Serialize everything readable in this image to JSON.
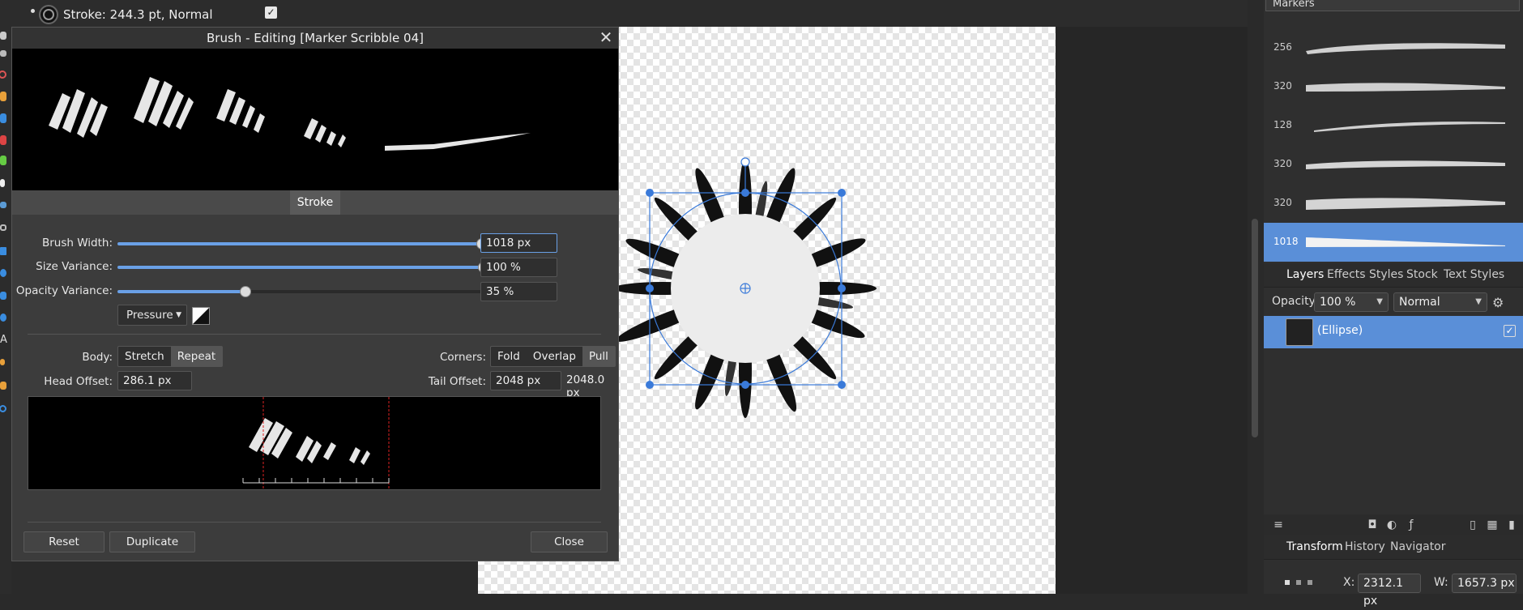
{
  "context_bar": {
    "stroke_text": "Stroke: 244.3 pt,  Normal",
    "checkbox": "✓"
  },
  "brushes_panel": {
    "category": "Markers",
    "brushes": [
      {
        "size": "256"
      },
      {
        "size": "320"
      },
      {
        "size": "128"
      },
      {
        "size": "320"
      },
      {
        "size": "320"
      },
      {
        "size": "1018",
        "selected": true
      }
    ]
  },
  "layers_panel": {
    "tabs": [
      "Layers",
      "Effects",
      "Styles",
      "Stock",
      "Text Styles"
    ],
    "opacity_label": "Opacity:",
    "opacity_value": "100 %",
    "blend_mode": "Normal",
    "layer_name": "(Ellipse)",
    "layer_visible": "✓"
  },
  "transform_panel": {
    "tabs": [
      "Transform",
      "History",
      "Navigator"
    ],
    "x_label": "X:",
    "x_value": "2312.1 px",
    "w_label": "W:",
    "w_value": "1657.3 px"
  },
  "dialog": {
    "title": "Brush - Editing [Marker Scribble 04]",
    "close": "✕",
    "tab": "Stroke",
    "brush_width_label": "Brush Width:",
    "brush_width_value": "1018 px",
    "brush_width_level": 1.0,
    "size_variance_label": "Size Variance:",
    "size_variance_value": "100 %",
    "size_variance_level": 1.0,
    "opacity_variance_label": "Opacity Variance:",
    "opacity_variance_value": "35 %",
    "opacity_variance_level": 0.35,
    "controller": "Pressure",
    "body_label": "Body:",
    "body_options": [
      "Stretch",
      "Repeat"
    ],
    "corners_label": "Corners:",
    "corner_options": [
      "Fold",
      "Overlap",
      "Pull"
    ],
    "head_offset_label": "Head Offset:",
    "head_offset_value": "286.1 px",
    "tail_offset_label": "Tail Offset:",
    "tail_offset_value": "2048 px",
    "nozzle_size": "2048.0 px",
    "reset": "Reset",
    "duplicate": "Duplicate",
    "close_button": "Close"
  },
  "colors": {
    "accent": "#5a8fd8",
    "dialog_bg": "#3c3c3c",
    "selection_blue": "#3a7ad9"
  }
}
